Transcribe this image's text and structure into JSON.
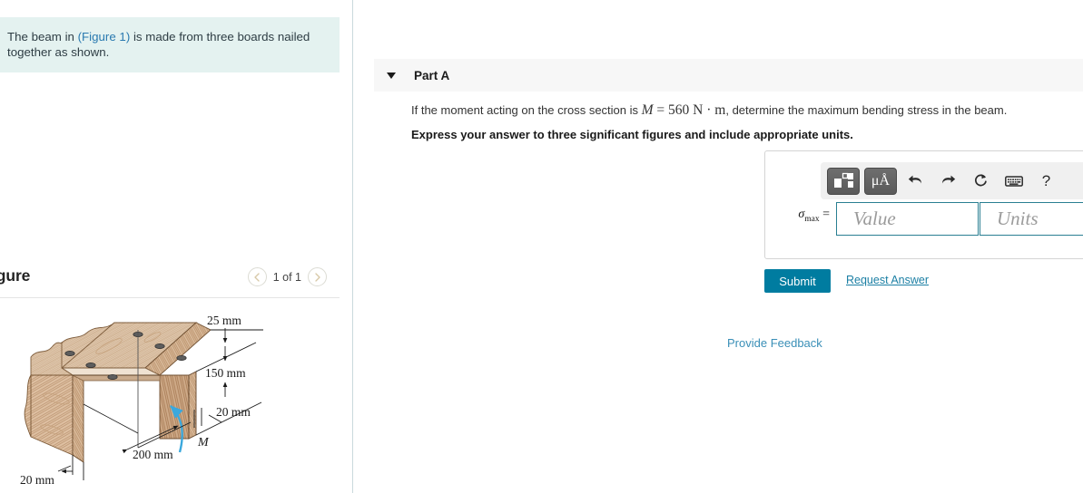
{
  "problem": {
    "text_before_link": "The beam in ",
    "figure_link": "(Figure 1)",
    "text_after_link": " is made from three boards nailed together as shown."
  },
  "figure_panel": {
    "title": "igure",
    "counter": "1 of 1",
    "prev_icon": "chevron-left-icon",
    "next_icon": "chevron-right-icon",
    "diagram": {
      "labels": {
        "d25": "25 mm",
        "d150": "150 mm",
        "d20_right": "20 mm",
        "d200": "200 mm",
        "d20_bottom": "20 mm",
        "moment": "M"
      },
      "colors": {
        "wood_light": "#e7d3bd",
        "wood_mid": "#d6b89b",
        "wood_dark": "#b8906c",
        "wood_edge": "#8a6240",
        "nail": "#5d5d5d",
        "arrow_blue": "#3aa8dd",
        "line": "#1a1a1a"
      }
    }
  },
  "part_a": {
    "caret_icon": "caret-down-icon",
    "title": "Part A",
    "question_prefix": "If the moment acting on the cross section is ",
    "moment_symbol": "M",
    "moment_equals": "=",
    "moment_value": "560",
    "moment_units": "N · m",
    "question_suffix": ", determine the maximum bending stress in the beam.",
    "instruction": "Express your answer to three significant figures and include appropriate units."
  },
  "answer_area": {
    "toolbar": [
      {
        "name": "math-template-button",
        "icon": "template-blocks-icon",
        "label": ""
      },
      {
        "name": "units-button",
        "icon": "micro-angstrom-icon",
        "label": "μÅ"
      },
      {
        "name": "undo-button",
        "icon": "undo-arrow-icon",
        "label": "↶"
      },
      {
        "name": "redo-button",
        "icon": "redo-arrow-icon",
        "label": "↷"
      },
      {
        "name": "reset-button",
        "icon": "reset-circular-arrow-icon",
        "label": "↻"
      },
      {
        "name": "keyboard-button",
        "icon": "keyboard-icon",
        "label": "⌨"
      },
      {
        "name": "help-button",
        "icon": "question-mark-icon",
        "label": "?"
      }
    ],
    "variable_label": "σmax =",
    "variable_base": "σ",
    "variable_sub": "max",
    "variable_eq": "=",
    "value_placeholder": "Value",
    "units_placeholder": "Units",
    "value_current": "",
    "units_current": ""
  },
  "actions": {
    "submit_label": "Submit",
    "request_answer_label": "Request Answer",
    "provide_feedback_label": "Provide Feedback"
  },
  "theme": {
    "problem_bg": "#e4f2f0",
    "link_blue": "#2a7ab0",
    "submit_bg": "#007ca0",
    "header_bg": "#f7f7f7",
    "field_border": "#2a7f92"
  }
}
